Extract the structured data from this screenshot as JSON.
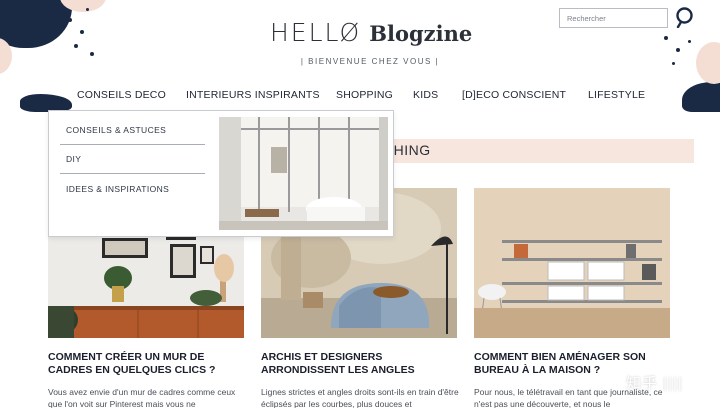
{
  "brand": {
    "hello": "HELLØ",
    "name": "Blogzine",
    "tagline": "| BIENVENUE CHEZ VOUS |"
  },
  "search": {
    "placeholder": "Rechercher",
    "icon": "search-icon"
  },
  "nav": {
    "items": [
      {
        "label": "CONSEILS DECO"
      },
      {
        "label": "INTERIEURS INSPIRANTS"
      },
      {
        "label": "SHOPPING"
      },
      {
        "label": "KIDS"
      },
      {
        "label": "[D]ECO CONSCIENT"
      },
      {
        "label": "LIFESTYLE"
      }
    ]
  },
  "dropdown": {
    "items": [
      {
        "label": "CONSEILS & ASTUCES"
      },
      {
        "label": "DIY"
      },
      {
        "label": "IDEES & INSPIRATIONS"
      }
    ]
  },
  "section": {
    "heading_visible": "CHING"
  },
  "cards": [
    {
      "title": "COMMENT CRÉER UN MUR DE CADRES EN QUELQUES CLICS ?",
      "excerpt": "Vous avez envie d'un mur de cadres comme ceux que l'on voit sur Pinterest mais vous ne"
    },
    {
      "title": "ARCHIS ET DESIGNERS ARRONDISSENT LES ANGLES",
      "excerpt": "Lignes strictes et angles droits sont-ils en train d'être éclipsés par les courbes, plus douces et"
    },
    {
      "title": "COMMENT BIEN AMÉNAGER SON BUREAU À LA MAISON ?",
      "excerpt": "Pour nous, le télétravail en tant que journaliste, ce n'est pas une découverte, et nous le"
    }
  ],
  "watermark": "知乎 ||||",
  "colors": {
    "navy": "#1b2a44",
    "peach": "#f6e6de",
    "text": "#1d2433"
  }
}
